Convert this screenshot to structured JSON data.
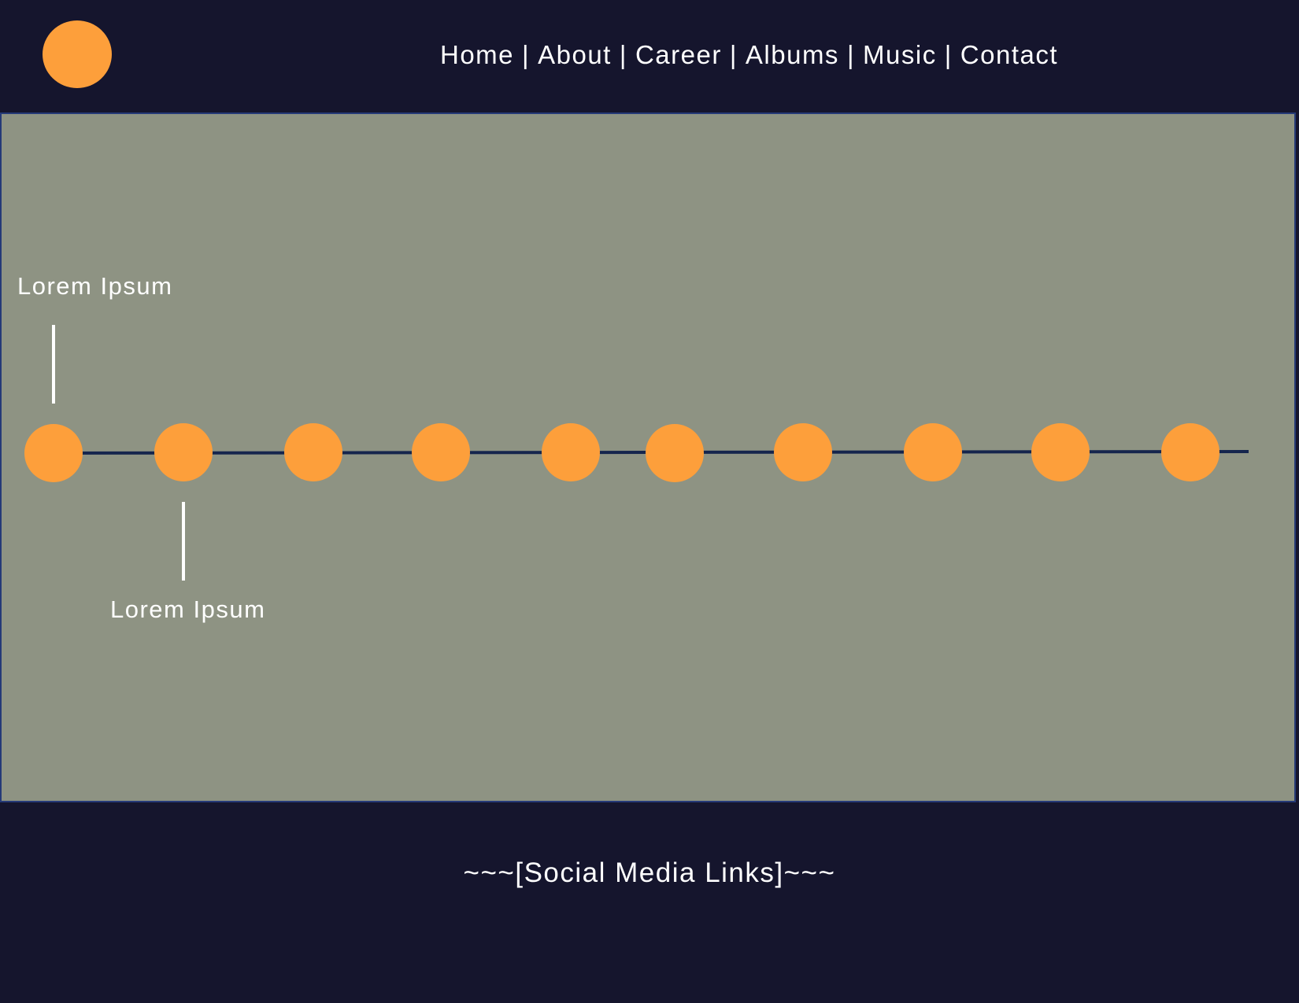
{
  "colors": {
    "background": "#15152d",
    "panel": "#8e9383",
    "accent": "#fd9f3b",
    "timeline_line": "#15254d",
    "text": "#ffffff"
  },
  "header": {
    "logo": "orange-circle-logo",
    "nav": [
      {
        "label": "Home"
      },
      {
        "label": "About"
      },
      {
        "label": "Career"
      },
      {
        "label": "Albums"
      },
      {
        "label": "Music"
      },
      {
        "label": "Contact"
      }
    ],
    "separator": "|"
  },
  "timeline": {
    "node_count": 10,
    "labels": [
      {
        "text": "Lorem Ipsum",
        "node": 1,
        "side": "above"
      },
      {
        "text": "Lorem Ipsum",
        "node": 2,
        "side": "below"
      }
    ]
  },
  "footer": {
    "social_text": "~~~[Social Media Links]~~~"
  }
}
